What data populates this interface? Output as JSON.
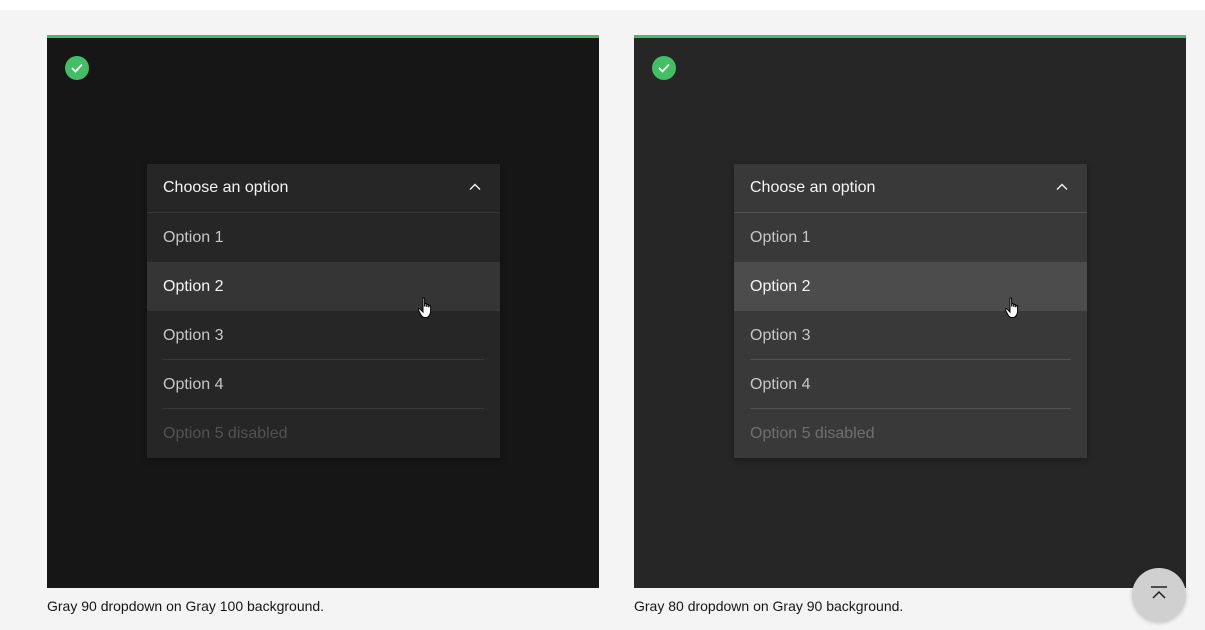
{
  "examples": [
    {
      "dropdown": {
        "label": "Choose an option",
        "options": [
          "Option 1",
          "Option 2",
          "Option 3",
          "Option 4",
          "Option 5 disabled"
        ]
      },
      "caption": "Gray 90 dropdown on Gray 100 background."
    },
    {
      "dropdown": {
        "label": "Choose an option",
        "options": [
          "Option 1",
          "Option 2",
          "Option 3",
          "Option 4",
          "Option 5 disabled"
        ]
      },
      "caption": "Gray 80 dropdown on Gray 90 background."
    }
  ],
  "icons": {
    "status": "checkmark-filled-icon",
    "chevron": "chevron-up-icon",
    "cursor": "pointer-hand-icon",
    "back_to_top": "back-to-top-icon"
  },
  "colors": {
    "success": "#42be65",
    "gray100": "#161616",
    "gray90": "#262626",
    "gray80": "#393939"
  }
}
